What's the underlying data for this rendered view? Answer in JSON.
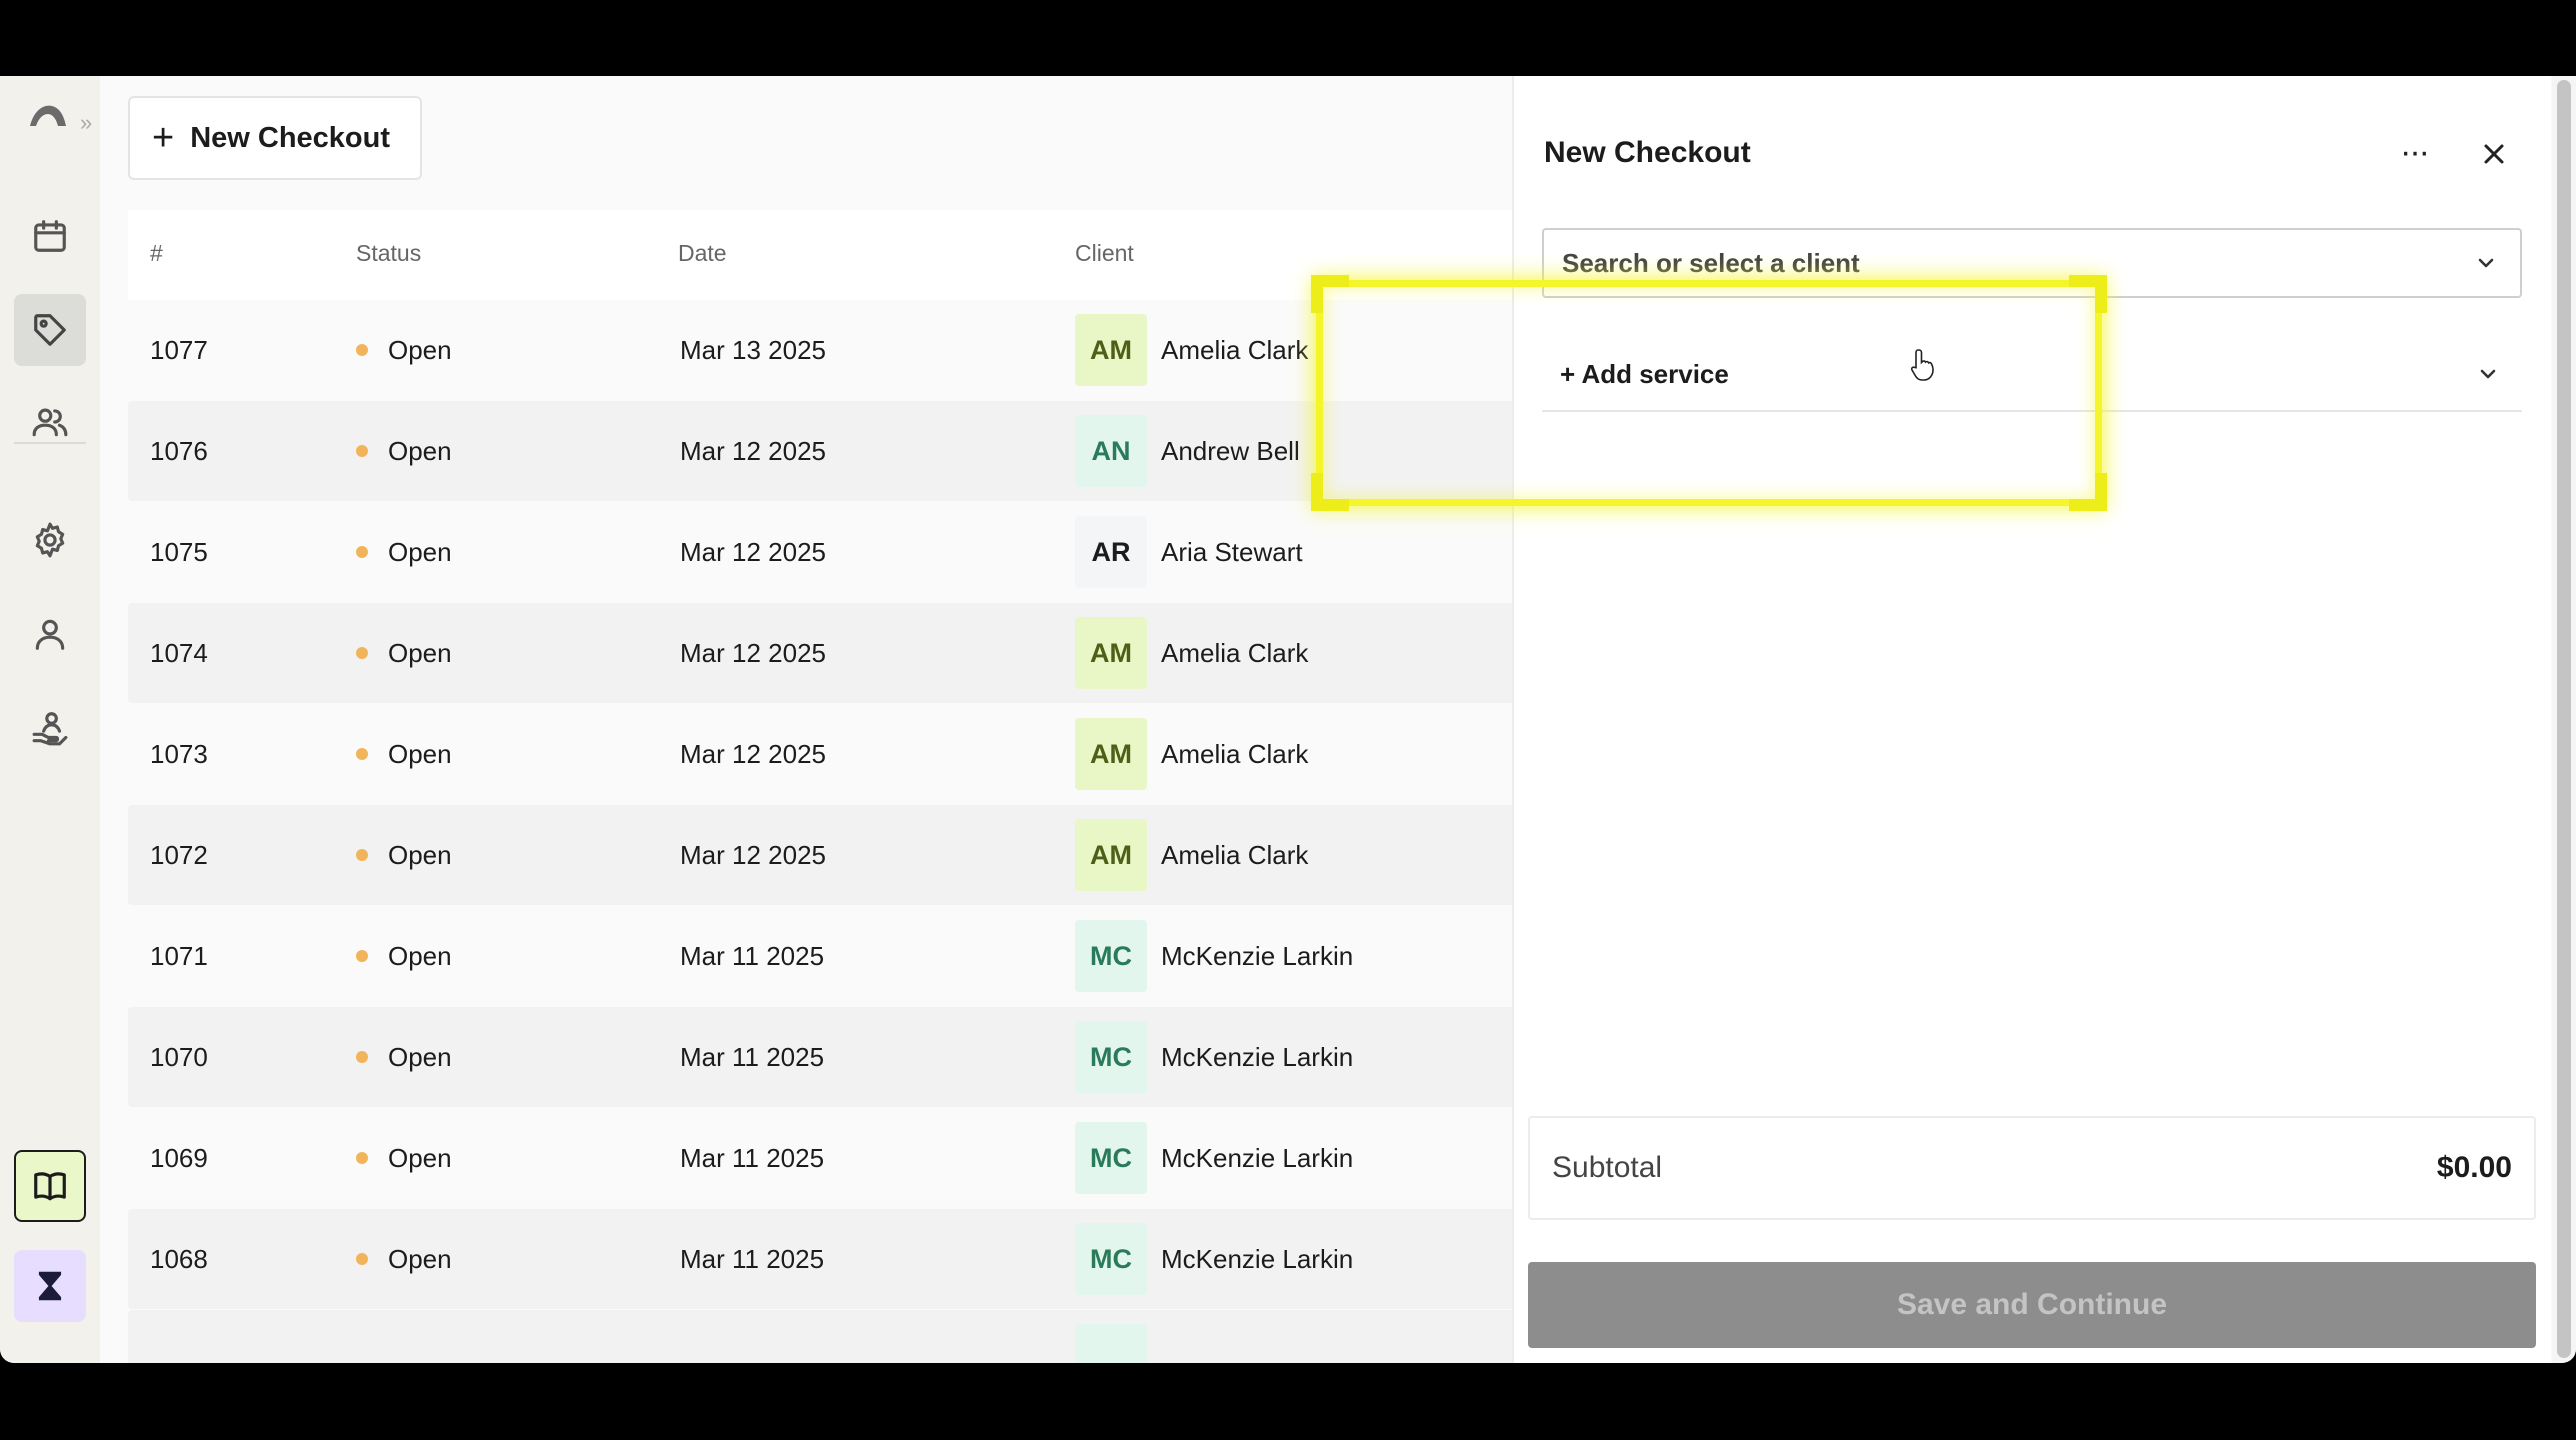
{
  "action_button": {
    "plus": "+",
    "label": "New Checkout"
  },
  "table": {
    "columns": [
      "#",
      "Status",
      "Date",
      "Client"
    ],
    "rows": [
      {
        "id": "1077",
        "status": "Open",
        "date": "Mar 13 2025",
        "initials": "AM",
        "client": "Amelia Clark"
      },
      {
        "id": "1076",
        "status": "Open",
        "date": "Mar 12 2025",
        "initials": "AN",
        "client": "Andrew Bell"
      },
      {
        "id": "1075",
        "status": "Open",
        "date": "Mar 12 2025",
        "initials": "AR",
        "client": "Aria Stewart"
      },
      {
        "id": "1074",
        "status": "Open",
        "date": "Mar 12 2025",
        "initials": "AM",
        "client": "Amelia Clark"
      },
      {
        "id": "1073",
        "status": "Open",
        "date": "Mar 12 2025",
        "initials": "AM",
        "client": "Amelia Clark"
      },
      {
        "id": "1072",
        "status": "Open",
        "date": "Mar 12 2025",
        "initials": "AM",
        "client": "Amelia Clark"
      },
      {
        "id": "1071",
        "status": "Open",
        "date": "Mar 11 2025",
        "initials": "MC",
        "client": "McKenzie Larkin"
      },
      {
        "id": "1070",
        "status": "Open",
        "date": "Mar 11 2025",
        "initials": "MC",
        "client": "McKenzie Larkin"
      },
      {
        "id": "1069",
        "status": "Open",
        "date": "Mar 11 2025",
        "initials": "MC",
        "client": "McKenzie Larkin"
      },
      {
        "id": "1068",
        "status": "Open",
        "date": "Mar 11 2025",
        "initials": "MC",
        "client": "McKenzie Larkin"
      }
    ]
  },
  "panel": {
    "title": "New Checkout",
    "more_glyph": "···",
    "client_select_placeholder": "Search or select a client",
    "add_service_label": "+ Add service",
    "subtotal_label": "Subtotal",
    "subtotal_value": "$0.00",
    "save_label": "Save and Continue"
  },
  "sidebar": {
    "icons": [
      "logo-icon",
      "calendar-icon",
      "tag-icon",
      "users-icon",
      "gear-icon",
      "person-icon",
      "hand-person-icon",
      "book-icon",
      "hourglass-icon"
    ],
    "active": "tag-icon"
  },
  "colors": {
    "status_open": "#f2b45a",
    "highlight": "#f4f52b",
    "avatar_lime_bg": "#e9f7c6",
    "avatar_mint_bg": "#e2f6ee",
    "save_disabled_bg": "#8d8d8d"
  }
}
